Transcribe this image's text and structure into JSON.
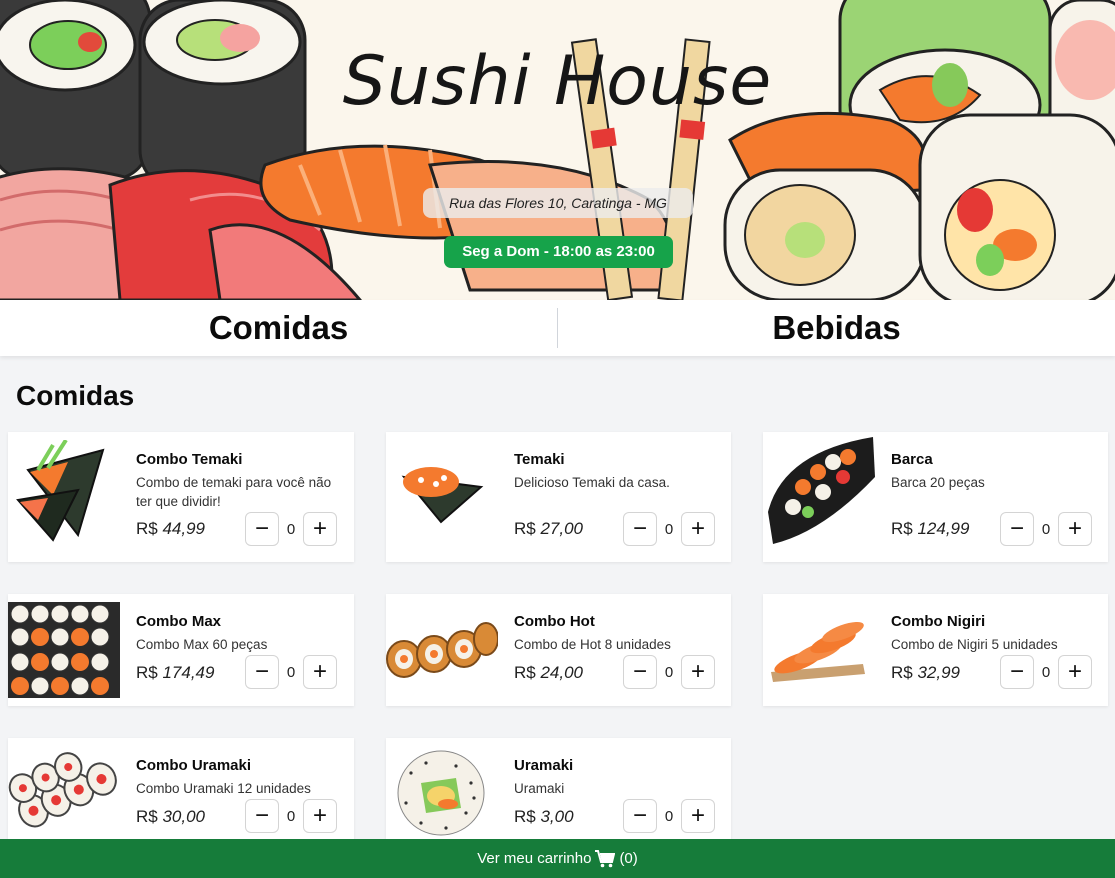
{
  "hero": {
    "title": "Sushi House",
    "address": "Rua das Flores 10, Caratinga - MG",
    "hours": "Seg a Dom - 18:00 as 23:00"
  },
  "tabs": [
    {
      "label": "Comidas"
    },
    {
      "label": "Bebidas"
    }
  ],
  "section": {
    "title": "Comidas"
  },
  "products": [
    {
      "name": "Combo Temaki",
      "description": "Combo de temaki para você não ter que dividir!",
      "currency": "R$",
      "price": "44,99",
      "quantity": "0",
      "image": "temaki-combo-photo"
    },
    {
      "name": "Temaki",
      "description": "Delicioso Temaki da casa.",
      "currency": "R$",
      "price": "27,00",
      "quantity": "0",
      "image": "temaki-photo"
    },
    {
      "name": "Barca",
      "description": "Barca 20 peças",
      "currency": "R$",
      "price": "124,99",
      "quantity": "0",
      "image": "barca-photo"
    },
    {
      "name": "Combo Max",
      "description": "Combo Max 60 peças",
      "currency": "R$",
      "price": "174,49",
      "quantity": "0",
      "image": "combo-max-photo"
    },
    {
      "name": "Combo Hot",
      "description": "Combo de Hot 8 unidades",
      "currency": "R$",
      "price": "24,00",
      "quantity": "0",
      "image": "combo-hot-photo"
    },
    {
      "name": "Combo Nigiri",
      "description": "Combo de Nigiri 5 unidades",
      "currency": "R$",
      "price": "32,99",
      "quantity": "0",
      "image": "combo-nigiri-photo"
    },
    {
      "name": "Combo Uramaki",
      "description": "Combo Uramaki 12 unidades",
      "currency": "R$",
      "price": "30,00",
      "quantity": "0",
      "image": "combo-uramaki-photo"
    },
    {
      "name": "Uramaki",
      "description": "Uramaki",
      "currency": "R$",
      "price": "3,00",
      "quantity": "0",
      "image": "uramaki-photo"
    }
  ],
  "qty_controls": {
    "minus": "−",
    "plus": "+"
  },
  "cart": {
    "label": "Ver meu carrinho",
    "count": "(0)",
    "icon": "cart-icon"
  },
  "colors": {
    "accent_green": "#16a34a",
    "cart_bar": "#167c3a",
    "background": "#f3f4f6"
  }
}
